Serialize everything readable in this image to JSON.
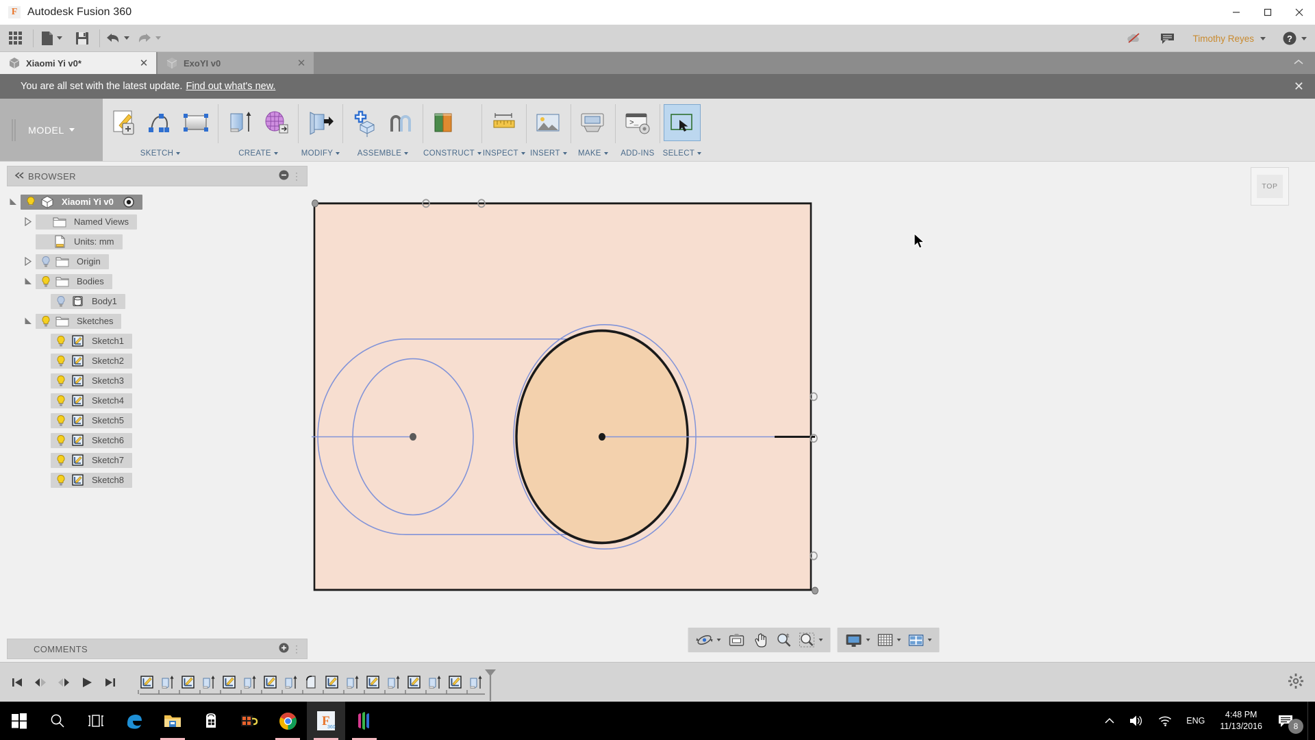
{
  "window": {
    "app_title": "Autodesk Fusion 360",
    "logo_letter": "F",
    "minimize": "─",
    "maximize": "□",
    "close": "✕"
  },
  "quick_access": {
    "buttons": [
      {
        "name": "app-grid",
        "icon": "grid-icon"
      },
      {
        "name": "new-document",
        "icon": "file-icon",
        "has_caret": true
      },
      {
        "name": "save",
        "icon": "save-icon"
      },
      {
        "name": "undo",
        "icon": "undo-icon",
        "has_caret": true
      },
      {
        "name": "redo",
        "icon": "redo-icon",
        "has_caret": true
      }
    ],
    "cloud_status_icon": "cloud-offline-icon",
    "comments_icon": "comment-icon",
    "user_name": "Timothy Reyes",
    "help_icon": "help-icon"
  },
  "tabs": [
    {
      "label": "Xiaomi Yi v0*",
      "active": true,
      "close": "✕"
    },
    {
      "label": "ExoYI v0",
      "active": false,
      "close": "✕"
    }
  ],
  "notification": {
    "message": "You are all set with the latest update.",
    "link": "Find out what's new.",
    "close": "✕"
  },
  "ribbon": {
    "workspace": "MODEL",
    "panels": [
      {
        "label": "SKETCH",
        "caret": true,
        "buttons": [
          "create-sketch-icon",
          "spline-icon",
          "rectangle-icon"
        ]
      },
      {
        "label": "CREATE",
        "caret": true,
        "buttons": [
          "extrude-icon",
          "mesh-icon"
        ]
      },
      {
        "label": "MODIFY",
        "caret": true,
        "buttons": [
          "press-pull-icon"
        ]
      },
      {
        "label": "ASSEMBLE",
        "caret": true,
        "buttons": [
          "new-component-icon",
          "joint-icon"
        ]
      },
      {
        "label": "CONSTRUCT",
        "caret": true,
        "buttons": [
          "offset-plane-icon"
        ]
      },
      {
        "label": "INSPECT",
        "caret": true,
        "buttons": [
          "measure-icon"
        ]
      },
      {
        "label": "INSERT",
        "caret": true,
        "buttons": [
          "insert-canvas-icon"
        ]
      },
      {
        "label": "MAKE",
        "caret": true,
        "buttons": [
          "3d-print-icon"
        ]
      },
      {
        "label": "ADD-INS",
        "caret": false,
        "buttons": [
          "scripts-addins-icon"
        ]
      },
      {
        "label": "SELECT",
        "caret": true,
        "buttons": [
          "select-window-icon"
        ]
      }
    ]
  },
  "browser": {
    "title": "BROWSER",
    "collapse_icon": "collapse-left-icon",
    "minimize_icon": "minus-circle-icon",
    "items": [
      {
        "label": "Xiaomi Yi v0",
        "indent": 0,
        "expander": "expanded",
        "bulb": "on",
        "icon": "component-icon",
        "selected": true,
        "radio": true
      },
      {
        "label": "Named Views",
        "indent": 1,
        "expander": "collapsed",
        "bulb": "none",
        "icon": "folder-icon",
        "selected": false,
        "radio": false
      },
      {
        "label": "Units: mm",
        "indent": 1,
        "expander": "none",
        "bulb": "none",
        "icon": "units-icon",
        "selected": false,
        "radio": false
      },
      {
        "label": "Origin",
        "indent": 1,
        "expander": "collapsed",
        "bulb": "off",
        "icon": "folder-icon",
        "selected": false,
        "radio": false
      },
      {
        "label": "Bodies",
        "indent": 1,
        "expander": "expanded",
        "bulb": "on",
        "icon": "folder-icon",
        "selected": false,
        "radio": false
      },
      {
        "label": "Body1",
        "indent": 2,
        "expander": "none",
        "bulb": "off",
        "icon": "body-icon",
        "selected": false,
        "radio": false
      },
      {
        "label": "Sketches",
        "indent": 1,
        "expander": "expanded",
        "bulb": "on",
        "icon": "folder-icon",
        "selected": false,
        "radio": false
      },
      {
        "label": "Sketch1",
        "indent": 2,
        "expander": "none",
        "bulb": "on",
        "icon": "sketch-icon",
        "selected": false,
        "radio": false
      },
      {
        "label": "Sketch2",
        "indent": 2,
        "expander": "none",
        "bulb": "on",
        "icon": "sketch-icon",
        "selected": false,
        "radio": false
      },
      {
        "label": "Sketch3",
        "indent": 2,
        "expander": "none",
        "bulb": "on",
        "icon": "sketch-icon",
        "selected": false,
        "radio": false
      },
      {
        "label": "Sketch4",
        "indent": 2,
        "expander": "none",
        "bulb": "on",
        "icon": "sketch-icon",
        "selected": false,
        "radio": false
      },
      {
        "label": "Sketch5",
        "indent": 2,
        "expander": "none",
        "bulb": "on",
        "icon": "sketch-icon",
        "selected": false,
        "radio": false
      },
      {
        "label": "Sketch6",
        "indent": 2,
        "expander": "none",
        "bulb": "on",
        "icon": "sketch-icon",
        "selected": false,
        "radio": false
      },
      {
        "label": "Sketch7",
        "indent": 2,
        "expander": "none",
        "bulb": "on",
        "icon": "sketch-icon",
        "selected": false,
        "radio": false
      },
      {
        "label": "Sketch8",
        "indent": 2,
        "expander": "none",
        "bulb": "on",
        "icon": "sketch-icon",
        "selected": false,
        "radio": false
      }
    ]
  },
  "comments": {
    "title": "COMMENTS",
    "add_icon": "plus-circle-icon"
  },
  "canvas": {
    "view_cube_label": "TOP",
    "body_fill": "#f7ded0",
    "circle_fill": "#f3d1ad",
    "sketch_line_color": "#8193d8",
    "edge_color": "#1a1a1a"
  },
  "navbar": {
    "group1": [
      {
        "name": "orbit-icon",
        "caret": true
      },
      {
        "name": "look-at-icon",
        "caret": false
      },
      {
        "name": "pan-icon",
        "caret": false
      },
      {
        "name": "zoom-icon",
        "caret": false
      },
      {
        "name": "zoom-window-icon",
        "caret": true
      }
    ],
    "group2": [
      {
        "name": "display-settings-icon",
        "caret": true
      },
      {
        "name": "grid-snaps-icon",
        "caret": true
      },
      {
        "name": "viewports-icon",
        "caret": true
      }
    ]
  },
  "timeline": {
    "playback": [
      "skip-to-start-icon",
      "step-back-icon",
      "step-forward-icon",
      "play-icon",
      "skip-to-end-icon"
    ],
    "features": [
      "sketch-icon",
      "extrude-icon",
      "sketch-icon",
      "extrude-icon",
      "sketch-icon",
      "extrude-icon",
      "sketch-icon",
      "extrude-icon",
      "fillet-icon",
      "sketch-icon",
      "extrude-icon",
      "sketch-icon",
      "extrude-icon",
      "sketch-icon",
      "extrude-icon",
      "sketch-icon",
      "extrude-icon"
    ],
    "settings_icon": "gear-icon"
  },
  "taskbar": {
    "items": [
      {
        "name": "start-button",
        "icon": "windows-logo-icon",
        "active": false,
        "underline": false
      },
      {
        "name": "search-button",
        "icon": "search-icon",
        "active": false,
        "underline": false
      },
      {
        "name": "task-view-button",
        "icon": "task-view-icon",
        "active": false,
        "underline": false
      },
      {
        "name": "edge-button",
        "icon": "edge-icon",
        "active": false,
        "underline": false
      },
      {
        "name": "file-explorer-button",
        "icon": "folder-icon",
        "active": false,
        "underline": true
      },
      {
        "name": "store-button",
        "icon": "store-icon",
        "active": false,
        "underline": false
      },
      {
        "name": "movie-maker-button",
        "icon": "film-icon",
        "active": false,
        "underline": false
      },
      {
        "name": "chrome-button",
        "icon": "chrome-icon",
        "active": false,
        "underline": true
      },
      {
        "name": "fusion-360-button",
        "icon": "fusion-icon",
        "active": true,
        "underline": true
      },
      {
        "name": "app-button",
        "icon": "colorful-app-icon",
        "active": false,
        "underline": true
      }
    ],
    "tray": {
      "show_hidden": "show-hidden-icons-icon",
      "volume": "speaker-icon",
      "network": "wifi-icon",
      "language": "ENG",
      "time": "4:48 PM",
      "date": "11/13/2016",
      "action_center_icon": "notification-icon",
      "action_center_count": "8"
    }
  }
}
